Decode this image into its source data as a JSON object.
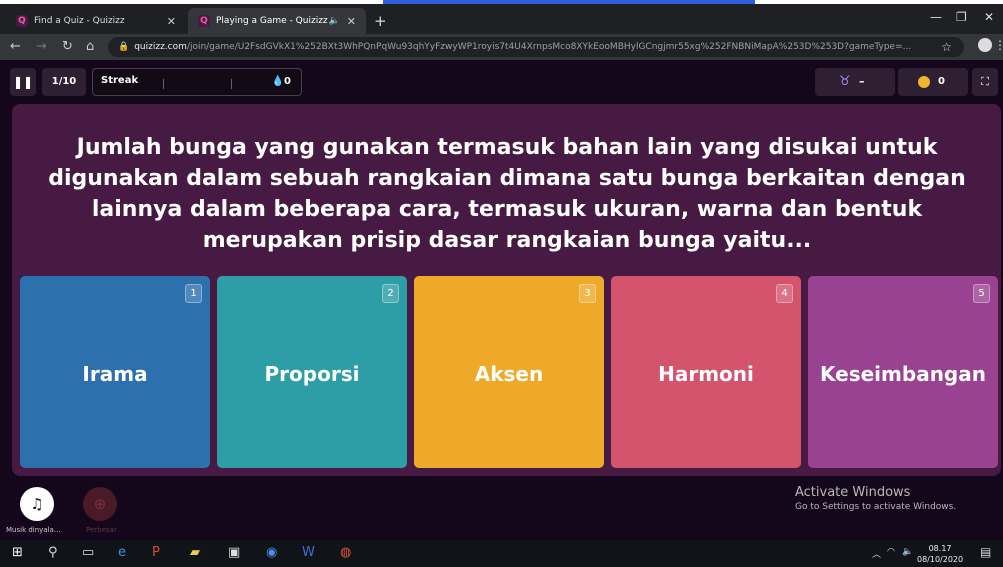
{
  "browser": {
    "tabs": [
      {
        "title": "Find a Quiz - Quizizz",
        "active": false
      },
      {
        "title": "Playing a Game - Quizizz",
        "active": true
      }
    ],
    "url_host": "quizizz.com",
    "url_path": "/join/game/U2FsdGVkX1%252BXt3WhPQnPqWu93qhYyFzwyWP1royis7t4U4XrnpsMco8XYkEooMBHylGCngjmr55xg%252FNBNiMapA%253D%253D?gameType=..."
  },
  "hud": {
    "question_counter": "1/10",
    "streak_label": "Streak",
    "streak_points": "0",
    "powerup_value": "–",
    "coins": "0"
  },
  "question": {
    "text": "Jumlah bunga yang gunakan termasuk bahan lain yang disukai untuk digunakan dalam sebuah rangkaian dimana satu bunga berkaitan dengan lainnya dalam beberapa cara, termasuk ukuran, warna dan bentuk merupakan prisip dasar rangkaian bunga yaitu..."
  },
  "options": [
    {
      "number": "1",
      "label": "Irama",
      "color": "#2d70ae"
    },
    {
      "number": "2",
      "label": "Proporsi",
      "color": "#2d9da6"
    },
    {
      "number": "3",
      "label": "Aksen",
      "color": "#efa929"
    },
    {
      "number": "4",
      "label": "Harmoni",
      "color": "#d5546d"
    },
    {
      "number": "5",
      "label": "Keseimbangan",
      "color": "#9a4292"
    }
  ],
  "bottom": {
    "music_label": "Musik dinyala...",
    "zoom_label": "Perbesar"
  },
  "watermark": {
    "title": "Activate Windows",
    "subtitle": "Go to Settings to activate Windows."
  },
  "taskbar": {
    "time": "08.17",
    "date": "08/10/2020"
  }
}
